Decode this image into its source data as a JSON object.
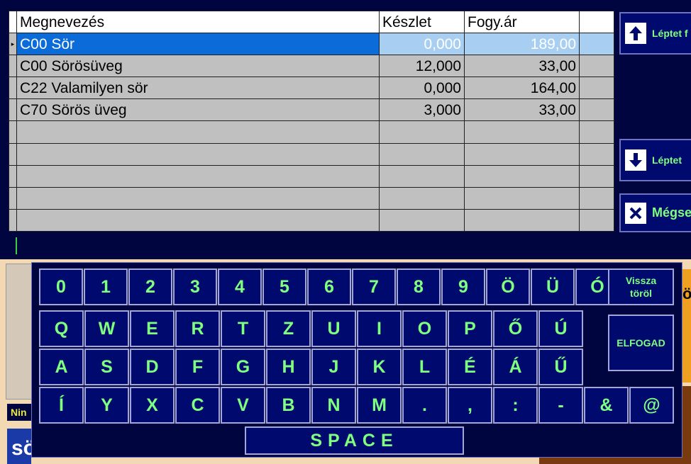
{
  "grid": {
    "headers": [
      "Megnevezés",
      "Készlet",
      "Fogy.ár"
    ],
    "rows": [
      {
        "name": "C00 Sör",
        "stock": "0,000",
        "price": "189,00",
        "selected": true
      },
      {
        "name": "C00 Sörösüveg",
        "stock": "12,000",
        "price": "33,00"
      },
      {
        "name": "C22 Valamilyen sör",
        "stock": "0,000",
        "price": "164,00"
      },
      {
        "name": "C70 Sörös üveg",
        "stock": "3,000",
        "price": "33,00"
      }
    ],
    "row_indicator": "▸"
  },
  "side_buttons": {
    "step_up": "Léptet f",
    "step_down": "Léptet",
    "cancel": "Mégse"
  },
  "background": {
    "status_fragment": "Nin",
    "big_fragment": "sö",
    "orange_fragment": "ör"
  },
  "keyboard": {
    "row1": [
      "0",
      "1",
      "2",
      "3",
      "4",
      "5",
      "6",
      "7",
      "8",
      "9",
      "Ö",
      "Ü",
      "Ó"
    ],
    "row2": [
      "Q",
      "W",
      "E",
      "R",
      "T",
      "Z",
      "U",
      "I",
      "O",
      "P",
      "Ő",
      "Ú"
    ],
    "row3": [
      "A",
      "S",
      "D",
      "F",
      "G",
      "H",
      "J",
      "K",
      "L",
      "É",
      "Á",
      "Ű"
    ],
    "row4": [
      "Í",
      "Y",
      "X",
      "C",
      "V",
      "B",
      "N",
      "M",
      ".",
      ",",
      ":",
      "-",
      "&",
      "@"
    ],
    "backspace": "Vissza\ntöröl",
    "accept": "ELFOGAD",
    "space": "SPACE"
  },
  "colors": {
    "panel": "#000540",
    "key_bg": "#000a6e",
    "key_text": "#7fff7f",
    "selection": "#0b6cd9"
  }
}
